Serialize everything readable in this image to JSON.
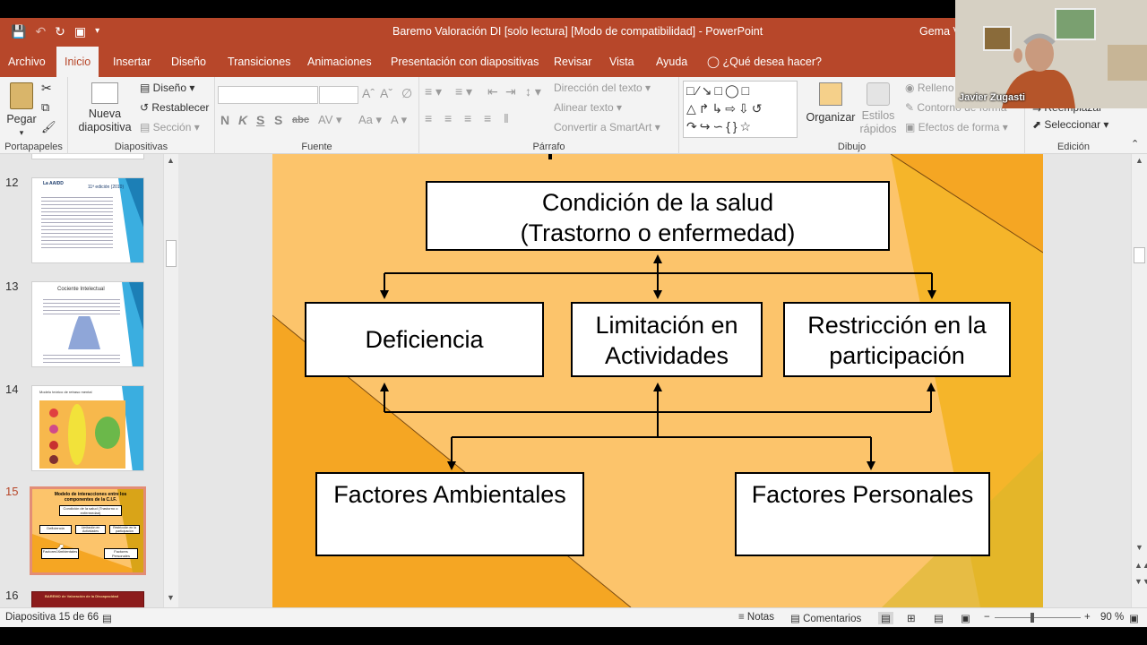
{
  "window": {
    "title": "Baremo Valoración DI [solo lectura] [Modo de compatibilidad]  -  PowerPoint",
    "user": "Gema V"
  },
  "tabs": [
    "Archivo",
    "Inicio",
    "Insertar",
    "Diseño",
    "Transiciones",
    "Animaciones",
    "Presentación con diapositivas",
    "Revisar",
    "Vista",
    "Ayuda",
    "¿Qué desea hacer?"
  ],
  "ribbon": {
    "clipboard": {
      "paste": "Pegar",
      "label": "Portapapeles"
    },
    "slides": {
      "new_slide_1": "Nueva",
      "new_slide_2": "diapositiva",
      "layout": "Diseño",
      "reset": "Restablecer",
      "section": "Sección",
      "label": "Diapositivas"
    },
    "font": {
      "label": "Fuente",
      "bold": "N",
      "italic": "K",
      "underline": "S",
      "shadow": "S",
      "strike": "abc"
    },
    "paragraph": {
      "text_direction": "Dirección del texto",
      "align_text": "Alinear texto",
      "smartart": "Convertir a SmartArt",
      "label": "Párrafo"
    },
    "drawing": {
      "arrange": "Organizar",
      "quick_styles_1": "Estilos",
      "quick_styles_2": "rápidos",
      "fill": "Relleno",
      "outline": "Contorno de forma",
      "effects": "Efectos de forma",
      "label": "Dibujo"
    },
    "editing": {
      "replace": "Reemplazar",
      "select": "Seleccionar",
      "label": "Edición"
    }
  },
  "webcam": {
    "name": "Javier Zugasti"
  },
  "thumbnails": [
    {
      "num": "12",
      "title": "La AAIDD",
      "subtitle": "11ª edición (2010)"
    },
    {
      "num": "13",
      "title": "Cociente Intelectual"
    },
    {
      "num": "14",
      "title": "Modelo teórico de retraso mental"
    },
    {
      "num": "15",
      "title": "Modelo de interacciones entre los componentes de la C.I.F.",
      "box1": "Condición de la salud (Trastorno o enfermedad)",
      "box2": "Deficiencia",
      "box3": "Limitación en Actividades",
      "box4": "Restricción en la participación",
      "box5": "Factores Ambientales",
      "box6": "Factores Personales"
    },
    {
      "num": "16",
      "title": "BAREMO de Valoración de la Discapacidad"
    }
  ],
  "slide": {
    "health_line1": "Condición de la salud",
    "health_line2": "(Trastorno o enfermedad)",
    "deficiency": "Deficiencia",
    "limitation_line1": "Limitación en",
    "limitation_line2": "Actividades",
    "restriction_line1": "Restricción en la",
    "restriction_line2": "participación",
    "env_factors": "Factores Ambientales",
    "personal_factors": "Factores Personales"
  },
  "status": {
    "slide_count": "Diapositiva 15 de 66",
    "notes": "Notas",
    "comments": "Comentarios",
    "zoom": "90 %"
  },
  "colors": {
    "accent": "#b7472a",
    "slide_bg": "#fcc46b",
    "slide_dark": "#f5a623"
  }
}
